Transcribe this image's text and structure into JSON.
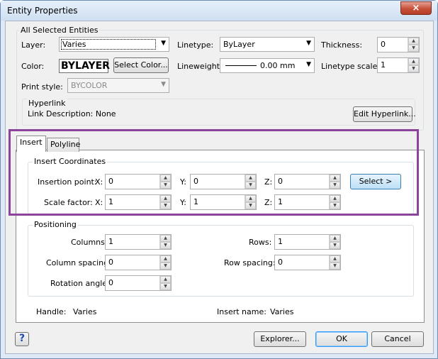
{
  "window": {
    "title": "Entity Properties",
    "close_icon": "×"
  },
  "all_selected": {
    "group_title": "All Selected Entities",
    "layer_label": "Layer:",
    "layer_value": "Varies",
    "linetype_label": "Linetype:",
    "linetype_value": "ByLayer",
    "thickness_label": "Thickness:",
    "thickness_value": "0",
    "color_label": "Color:",
    "color_value": "BYLAYER",
    "select_color_button": "Select Color...",
    "lineweight_label": "Lineweight:",
    "lineweight_value": "0.00 mm",
    "linetype_scale_label": "Linetype scale:",
    "linetype_scale_value": "1",
    "print_style_label": "Print style:",
    "print_style_value": "BYCOLOR"
  },
  "hyperlink": {
    "group_title": "Hyperlink",
    "description": "Link Description: None",
    "edit_button": "Edit Hyperlink..."
  },
  "tabs": [
    {
      "label": "Insert",
      "active": true
    },
    {
      "label": "Polyline",
      "active": false
    }
  ],
  "insert_coordinates": {
    "group_title": "Insert Coordinates",
    "insertion_point_label": "Insertion point:",
    "scale_factor_label": "Scale factor:",
    "x_label": "X:",
    "y_label": "Y:",
    "z_label": "Z:",
    "insertion_x": "0",
    "insertion_y": "0",
    "insertion_z": "0",
    "scale_x": "1",
    "scale_y": "1",
    "scale_z": "1",
    "select_button": "Select >"
  },
  "positioning": {
    "group_title": "Positioning",
    "columns_label": "Columns:",
    "columns_value": "1",
    "rows_label": "Rows:",
    "rows_value": "1",
    "column_spacing_label": "Column spacing:",
    "column_spacing_value": "0",
    "row_spacing_label": "Row spacing:",
    "row_spacing_value": "0",
    "rotation_angle_label": "Rotation angle:",
    "rotation_angle_value": "0"
  },
  "info": {
    "handle_label": "Handle:",
    "handle_value": "Varies",
    "insert_name_label": "Insert name:",
    "insert_name_value": "Varies"
  },
  "footer": {
    "help_icon": "?",
    "explorer_button": "Explorer...",
    "ok_button": "OK",
    "cancel_button": "Cancel"
  },
  "colors": {
    "highlight_border": "#8b449a",
    "title_bar": "#dfe9f5",
    "close_button": "#c7503a"
  }
}
